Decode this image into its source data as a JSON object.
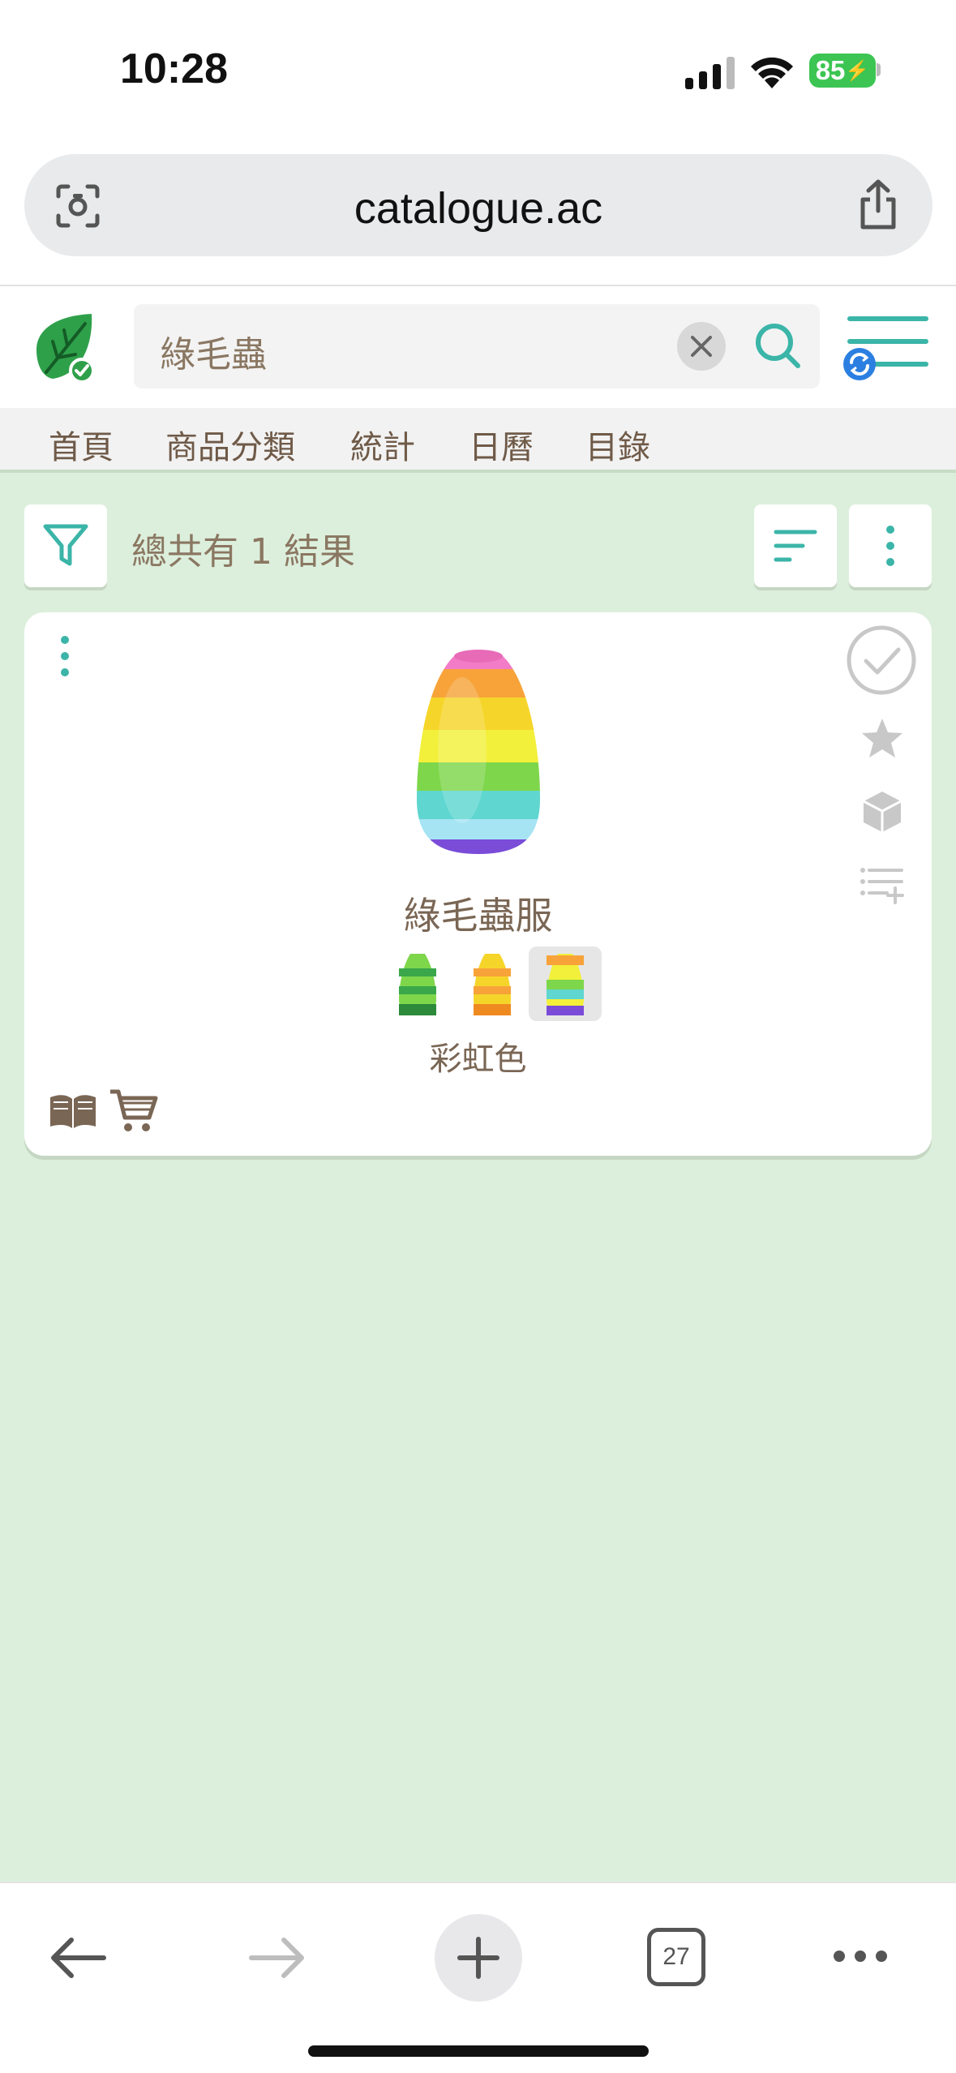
{
  "status_bar": {
    "time": "10:28",
    "battery": "85"
  },
  "browser": {
    "url": "catalogue.ac",
    "open_tabs": "27"
  },
  "header": {
    "search_value": "綠毛蟲"
  },
  "nav": {
    "items": [
      "首頁",
      "商品分類",
      "統計",
      "日曆",
      "目錄"
    ]
  },
  "results": {
    "count_text": "總共有 1 結果"
  },
  "item": {
    "name": "綠毛蟲服",
    "variants": [
      "green",
      "yellow",
      "rainbow"
    ],
    "selected_variant_index": 2,
    "selected_variant_name": "彩虹色"
  },
  "colors": {
    "accent": "#3bb5a8",
    "background": "#dcefdc",
    "text": "#7a6654",
    "leaf": "#2fa04a"
  }
}
